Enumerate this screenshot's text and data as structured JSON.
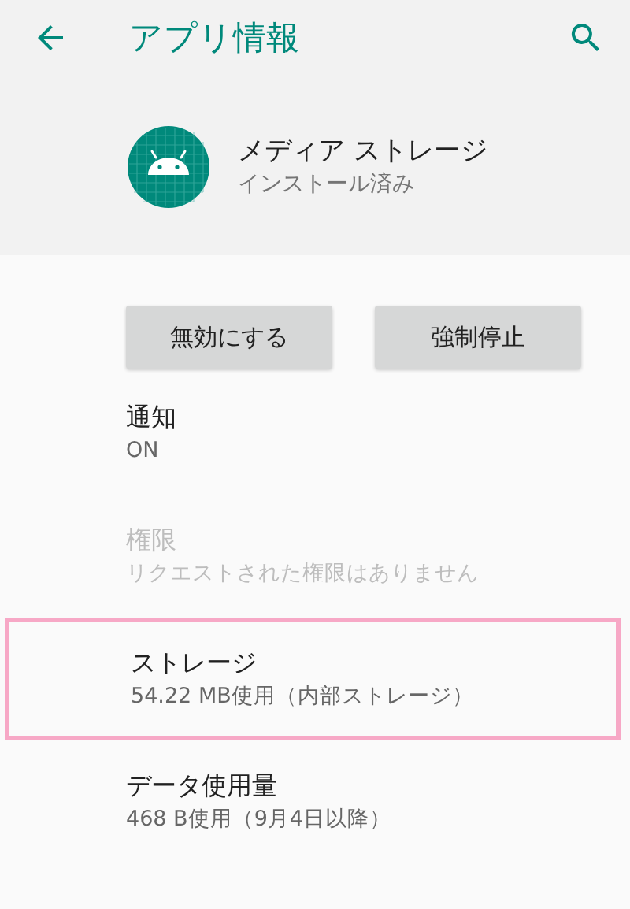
{
  "toolbar": {
    "title": "アプリ情報"
  },
  "app": {
    "name": "メディア ストレージ",
    "status": "インストール済み"
  },
  "buttons": [
    {
      "label": "無効にする"
    },
    {
      "label": "強制停止"
    }
  ],
  "items": [
    {
      "title": "通知",
      "summary": "ON",
      "disabled": false,
      "highlighted": false
    },
    {
      "title": "権限",
      "summary": "リクエストされた権限はありません",
      "disabled": true,
      "highlighted": false
    },
    {
      "title": "ストレージ",
      "summary": "54.22 MB使用（内部ストレージ）",
      "disabled": false,
      "highlighted": true
    },
    {
      "title": "データ使用量",
      "summary": "468 B使用（9月4日以降）",
      "disabled": false,
      "highlighted": false
    }
  ]
}
